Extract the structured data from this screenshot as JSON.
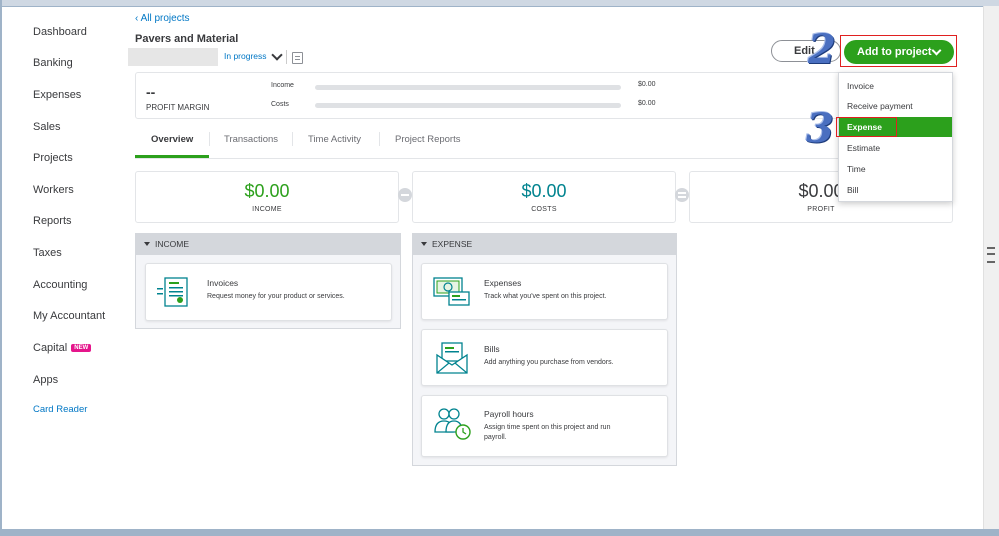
{
  "sidebar": {
    "items": [
      {
        "label": "Dashboard"
      },
      {
        "label": "Banking"
      },
      {
        "label": "Expenses"
      },
      {
        "label": "Sales"
      },
      {
        "label": "Projects"
      },
      {
        "label": "Workers"
      },
      {
        "label": "Reports"
      },
      {
        "label": "Taxes"
      },
      {
        "label": "Accounting"
      },
      {
        "label": "My Accountant"
      },
      {
        "label": "Capital",
        "badge": "NEW"
      },
      {
        "label": "Apps"
      },
      {
        "label": "Card Reader"
      }
    ]
  },
  "header": {
    "back_link": "All projects",
    "project_title": "Pavers and Material",
    "status": "In progress",
    "edit_label": "Edit",
    "add_label": "Add to project"
  },
  "annotations": {
    "step2": "2",
    "step3": "3"
  },
  "profit_margin": {
    "value": "--",
    "label": "PROFIT MARGIN",
    "income_label": "Income",
    "income_amount": "$0.00",
    "costs_label": "Costs",
    "costs_amount": "$0.00"
  },
  "tabs": [
    {
      "label": "Overview"
    },
    {
      "label": "Transactions"
    },
    {
      "label": "Time Activity"
    },
    {
      "label": "Project Reports"
    }
  ],
  "summary": {
    "income": {
      "value": "$0.00",
      "label": "INCOME"
    },
    "costs": {
      "value": "$0.00",
      "label": "COSTS"
    },
    "profit": {
      "value": "$0.00",
      "label": "PROFIT"
    }
  },
  "income_section": {
    "title": "INCOME",
    "tiles": [
      {
        "title": "Invoices",
        "desc": "Request money for your product or services."
      }
    ]
  },
  "expense_section": {
    "title": "EXPENSE",
    "tiles": [
      {
        "title": "Expenses",
        "desc": "Track what you've spent on this project."
      },
      {
        "title": "Bills",
        "desc": "Add anything you purchase from vendors."
      },
      {
        "title": "Payroll hours",
        "desc_line1": "Assign time spent on this project and run",
        "desc_line2": "payroll."
      }
    ]
  },
  "menu": {
    "items": [
      {
        "label": "Invoice"
      },
      {
        "label": "Receive payment"
      },
      {
        "label": "Expense"
      },
      {
        "label": "Estimate"
      },
      {
        "label": "Time"
      },
      {
        "label": "Bill"
      }
    ]
  },
  "colors": {
    "accent": "#2ca01c",
    "link": "#0077c5",
    "annotation_red": "#e02020"
  }
}
